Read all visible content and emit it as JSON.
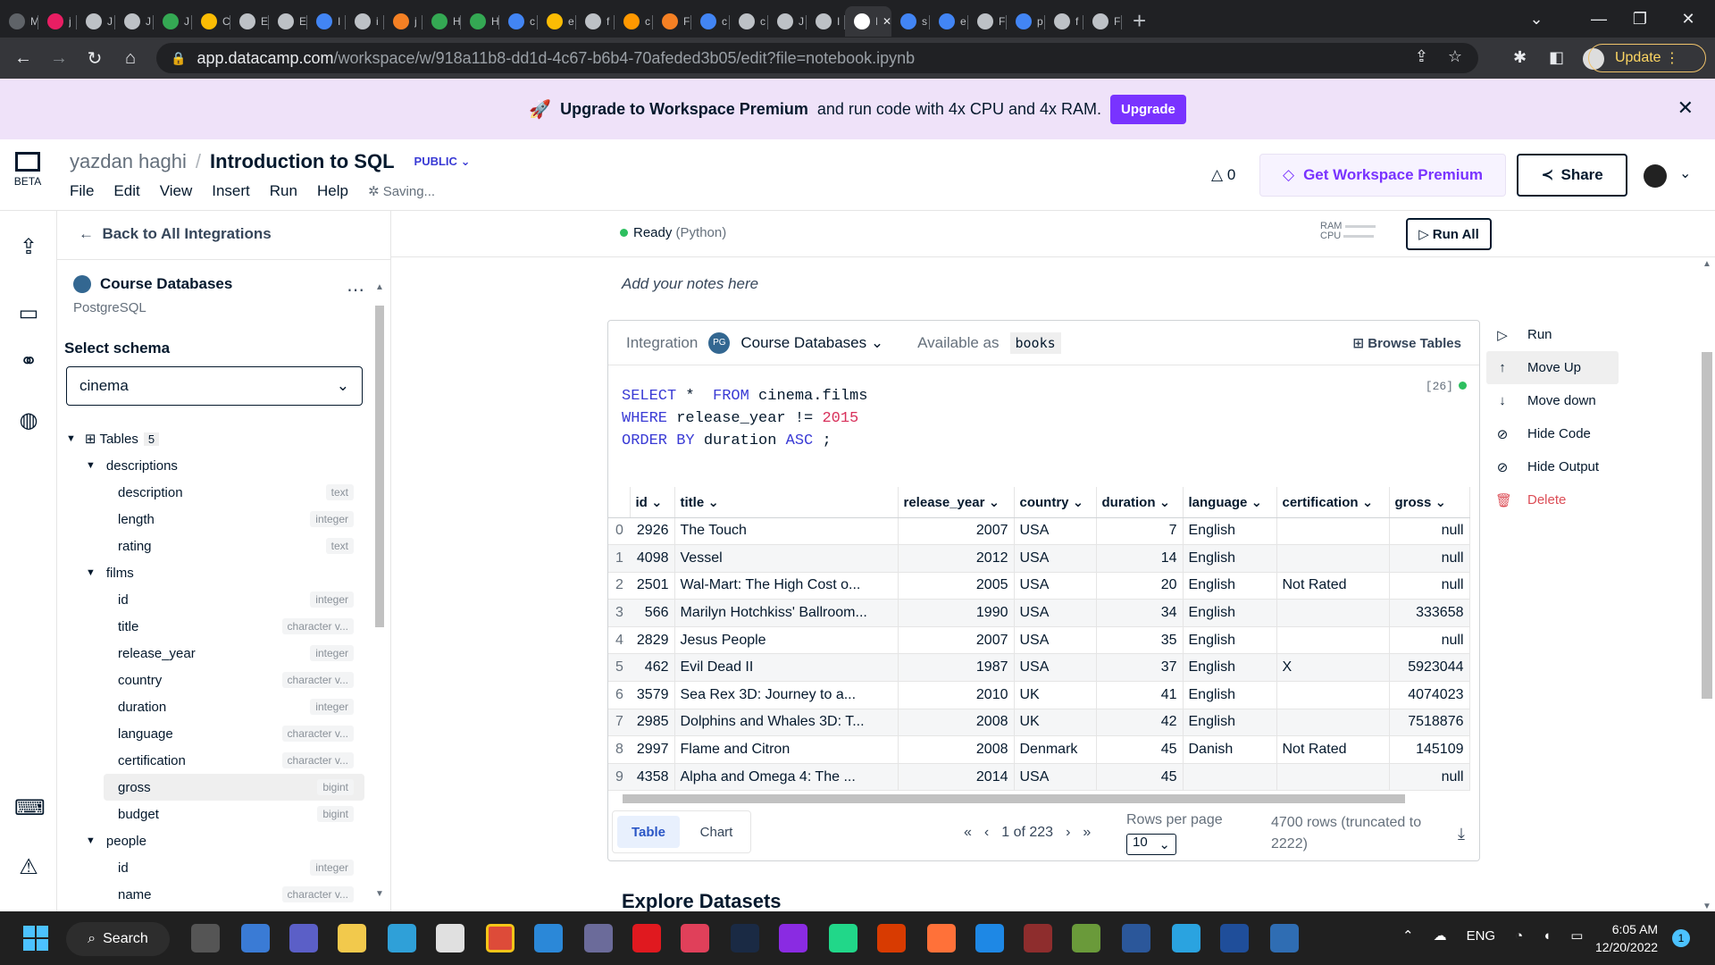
{
  "browser": {
    "tabs": [
      {
        "title": "M",
        "color": "#5f6368"
      },
      {
        "title": "j",
        "color": "#e91e63"
      },
      {
        "title": "J",
        "color": "#bdc1c6"
      },
      {
        "title": "J",
        "color": "#bdc1c6"
      },
      {
        "title": "J",
        "color": "#34a853"
      },
      {
        "title": "C",
        "color": "#fbbc04"
      },
      {
        "title": "E",
        "color": "#bdc1c6"
      },
      {
        "title": "E",
        "color": "#bdc1c6"
      },
      {
        "title": "I",
        "color": "#4285f4"
      },
      {
        "title": "i",
        "color": "#bdc1c6"
      },
      {
        "title": "j",
        "color": "#f48024"
      },
      {
        "title": "H",
        "color": "#34a853"
      },
      {
        "title": "H",
        "color": "#34a853"
      },
      {
        "title": "c",
        "color": "#4285f4"
      },
      {
        "title": "e",
        "color": "#fbbc04"
      },
      {
        "title": "f",
        "color": "#bdc1c6"
      },
      {
        "title": "c",
        "color": "#ff9800"
      },
      {
        "title": "F",
        "color": "#f48024"
      },
      {
        "title": "c",
        "color": "#4285f4"
      },
      {
        "title": "c",
        "color": "#bdc1c6"
      },
      {
        "title": "J",
        "color": "#bdc1c6"
      },
      {
        "title": "I",
        "color": "#bdc1c6"
      }
    ],
    "active_tab": {
      "title": "Ir"
    },
    "tabs_after": [
      {
        "title": "s",
        "color": "#4285f4"
      },
      {
        "title": "e",
        "color": "#4285f4"
      },
      {
        "title": "F",
        "color": "#bdc1c6"
      },
      {
        "title": "p",
        "color": "#4285f4"
      },
      {
        "title": "f",
        "color": "#bdc1c6"
      },
      {
        "title": "F",
        "color": "#bdc1c6"
      }
    ],
    "url_host": "app.datacamp.com",
    "url_rest": "/workspace/w/918a11b8-dd1d-4c67-b6b4-70afeded3b05/edit?file=notebook.ipynb",
    "update_label": "Update"
  },
  "banner": {
    "bold": "Upgrade to Workspace Premium",
    "text": "and run code with 4x CPU and 4x RAM.",
    "button": "Upgrade"
  },
  "header": {
    "logo_label": "BETA",
    "user": "yazdan haghi",
    "sep": "/",
    "notebook": "Introduction to SQL",
    "visibility": "PUBLIC",
    "menus": [
      "File",
      "Edit",
      "View",
      "Insert",
      "Run",
      "Help"
    ],
    "saving": "Saving...",
    "warnings": "0",
    "premium": "Get Workspace Premium",
    "share": "Share"
  },
  "sidebar": {
    "back": "Back to All Integrations",
    "db_name": "Course Databases",
    "db_type": "PostgreSQL",
    "schema_label": "Select schema",
    "schema_value": "cinema",
    "tables_label": "Tables",
    "tables_count": "5",
    "tree": [
      {
        "label": "descriptions",
        "level": 1,
        "type": ""
      },
      {
        "label": "description",
        "level": 2,
        "type": "text"
      },
      {
        "label": "length",
        "level": 2,
        "type": "integer"
      },
      {
        "label": "rating",
        "level": 2,
        "type": "text"
      },
      {
        "label": "films",
        "level": 1,
        "type": ""
      },
      {
        "label": "id",
        "level": 2,
        "type": "integer"
      },
      {
        "label": "title",
        "level": 2,
        "type": "character v..."
      },
      {
        "label": "release_year",
        "level": 2,
        "type": "integer"
      },
      {
        "label": "country",
        "level": 2,
        "type": "character v..."
      },
      {
        "label": "duration",
        "level": 2,
        "type": "integer"
      },
      {
        "label": "language",
        "level": 2,
        "type": "character v..."
      },
      {
        "label": "certification",
        "level": 2,
        "type": "character v..."
      },
      {
        "label": "gross",
        "level": 2,
        "type": "bigint"
      },
      {
        "label": "budget",
        "level": 2,
        "type": "bigint"
      },
      {
        "label": "people",
        "level": 1,
        "type": ""
      },
      {
        "label": "id",
        "level": 2,
        "type": "integer"
      },
      {
        "label": "name",
        "level": 2,
        "type": "character v..."
      },
      {
        "label": "birthdate",
        "level": 2,
        "type": "date"
      }
    ]
  },
  "status": {
    "ready": "Ready",
    "kernel": "(Python)",
    "ram": "RAM",
    "cpu": "CPU",
    "run_all": "Run All"
  },
  "notes": "Add your notes here",
  "cell": {
    "integration_label": "Integration",
    "integration_name": "Course Databases",
    "available_label": "Available as",
    "available_name": "books",
    "browse": "Browse Tables",
    "exec_count": "[26]",
    "code": {
      "l1_kw1": "SELECT",
      "l1_mid": " *  ",
      "l1_kw2": "FROM",
      "l1_rest": " cinema.films",
      "l2_kw": "WHERE",
      "l2_mid": " release_year != ",
      "l2_num": "2015",
      "l3_kw": "ORDER BY",
      "l3_mid": " duration ",
      "l3_kw2": "ASC",
      "l3_end": " ;"
    },
    "columns": [
      "id",
      "title",
      "release_year",
      "country",
      "duration",
      "language",
      "certification",
      "gross"
    ],
    "rows": [
      [
        "0",
        "2926",
        "The Touch",
        "2007",
        "USA",
        "7",
        "English",
        "",
        "null"
      ],
      [
        "1",
        "4098",
        "Vessel",
        "2012",
        "USA",
        "14",
        "English",
        "",
        "null"
      ],
      [
        "2",
        "2501",
        "Wal-Mart: The High Cost o...",
        "2005",
        "USA",
        "20",
        "English",
        "Not Rated",
        "null"
      ],
      [
        "3",
        "566",
        "Marilyn Hotchkiss' Ballroom...",
        "1990",
        "USA",
        "34",
        "English",
        "",
        "333658"
      ],
      [
        "4",
        "2829",
        "Jesus People",
        "2007",
        "USA",
        "35",
        "English",
        "",
        "null"
      ],
      [
        "5",
        "462",
        "Evil Dead II",
        "1987",
        "USA",
        "37",
        "English",
        "X",
        "5923044"
      ],
      [
        "6",
        "3579",
        "Sea Rex 3D: Journey to a...",
        "2010",
        "UK",
        "41",
        "English",
        "",
        "4074023"
      ],
      [
        "7",
        "2985",
        "Dolphins and Whales 3D: T...",
        "2008",
        "UK",
        "42",
        "English",
        "",
        "7518876"
      ],
      [
        "8",
        "2997",
        "Flame and Citron",
        "2008",
        "Denmark",
        "45",
        "Danish",
        "Not Rated",
        "145109"
      ],
      [
        "9",
        "4358",
        "Alpha and Omega 4: The ...",
        "2014",
        "USA",
        "45",
        "",
        "",
        "null"
      ]
    ],
    "tab_table": "Table",
    "tab_chart": "Chart",
    "page_info": "1 of 223",
    "rows_per_page_label": "Rows per page",
    "rows_per_page": "10",
    "rows_info": "4700 rows (truncated to 2222)"
  },
  "cell_menu": [
    "Run",
    "Move Up",
    "Move down",
    "Hide Code",
    "Hide Output",
    "Delete"
  ],
  "explore": "Explore Datasets",
  "taskbar": {
    "search": "Search",
    "lang": "ENG",
    "time": "6:05 AM",
    "date": "12/20/2022",
    "notifications": "1"
  }
}
